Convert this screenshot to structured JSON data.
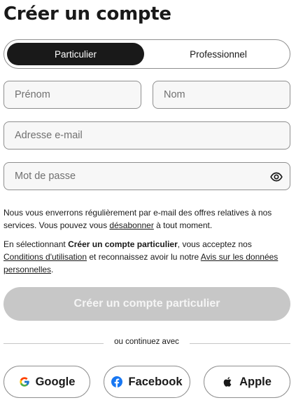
{
  "page": {
    "title": "Créer un compte"
  },
  "account_type": {
    "options": [
      "Particulier",
      "Professionnel"
    ],
    "selected": "Particulier"
  },
  "form": {
    "first_name": {
      "placeholder": "Prénom",
      "value": ""
    },
    "last_name": {
      "placeholder": "Nom",
      "value": ""
    },
    "email": {
      "placeholder": "Adresse e-mail",
      "value": ""
    },
    "password": {
      "placeholder": "Mot de passe",
      "value": ""
    },
    "password_toggle_icon": "eye-icon"
  },
  "notices": {
    "marketing_before": "Nous vous enverrons régulièrement par e-mail des offres relatives à nos services. Vous pouvez vous ",
    "marketing_link": "désabonner",
    "marketing_after": " à tout moment.",
    "terms_before": "En sélectionnant ",
    "terms_bold": "Créer un compte particulier",
    "terms_middle1": ", vous acceptez nos ",
    "terms_link1": "Conditions d'utilisation",
    "terms_middle2": " et reconnaissez avoir lu notre ",
    "terms_link2": "Avis sur les données personnelles",
    "terms_end": "."
  },
  "submit": {
    "label": "Créer un compte particulier",
    "enabled": false
  },
  "divider": {
    "label": "ou continuez avec"
  },
  "social": {
    "google": {
      "label": "Google",
      "icon": "google-icon"
    },
    "facebook": {
      "label": "Facebook",
      "icon": "facebook-icon"
    },
    "apple": {
      "label": "Apple",
      "icon": "apple-icon"
    }
  },
  "colors": {
    "text": "#191919",
    "toggle_active_bg": "#191919",
    "field_bg": "#f7f7f7",
    "border": "#8f8f8f",
    "submit_disabled_bg": "#c7c7c7",
    "facebook_blue": "#1877f2"
  }
}
